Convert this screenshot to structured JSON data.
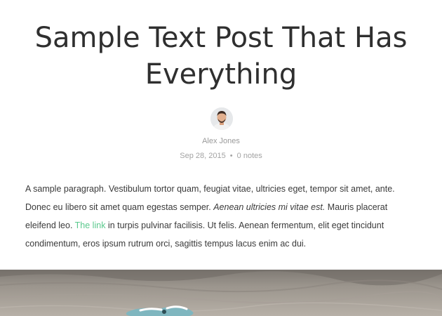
{
  "post": {
    "title": "Sample Text Post That Has Everything",
    "author": "Alex Jones",
    "date": "Sep 28, 2015",
    "separator": "•",
    "notes": "0 notes",
    "paragraph": {
      "part1": "A sample paragraph. Vestibulum tortor quam, feugiat vitae, ultricies eget, tempor sit amet, ante. Donec eu libero sit amet quam egestas semper. ",
      "italic": "Aenean ultricies mi vitae est.",
      "part2": " Mauris placerat eleifend leo. ",
      "link": "The link",
      "part3": " in turpis pulvinar facilisis. Ut felis. Aenean fermentum, elit eget tincidunt condimentum, eros ipsum rutrum orci, sagittis tempus lacus enim ac dui."
    }
  },
  "colors": {
    "link": "#5ac98d",
    "text": "#3a3a3a",
    "muted": "#a3a3a3"
  },
  "icons": {
    "avatar": "author-avatar"
  }
}
